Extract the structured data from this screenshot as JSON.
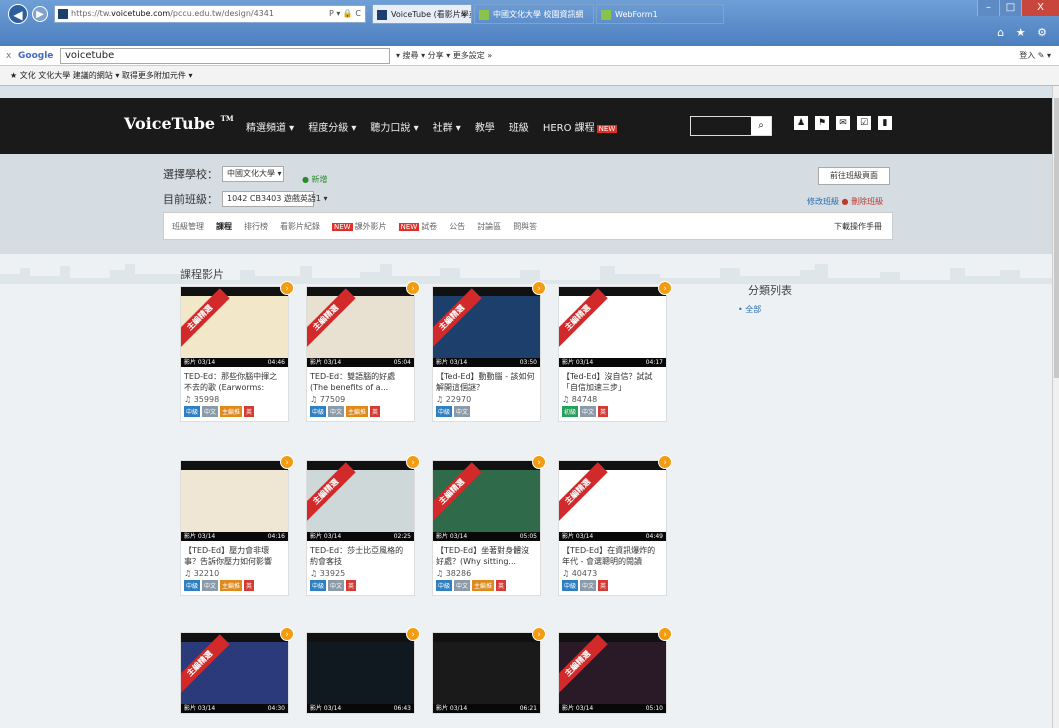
{
  "browser": {
    "url_prefix": "https://tw.",
    "url_host": "voicetube.com",
    "url_path": "/pccu.edu.tw/design/4341",
    "addr_icons": "P ▾ 🔒 C",
    "tabs": [
      {
        "label": "VoiceTube (看影片學英語...",
        "close": "×"
      },
      {
        "label": "中國文化大學 校園資訊網"
      },
      {
        "label": "WebForm1"
      }
    ],
    "window_controls": {
      "min": "–",
      "max": "□",
      "close": "X"
    },
    "right_icons": "⌂ ★ ⚙"
  },
  "google_toolbar": {
    "close": "x",
    "logo": "Google",
    "query": "voicetube",
    "tools": "▾ 搜尋 ▾  分享  ▾  更多設定 »",
    "login": "登入 ✎ ▾"
  },
  "favorites": {
    "text": "★  文化  文化大學  建議的網站 ▾  取得更多附加元件 ▾"
  },
  "header": {
    "logo": "VoiceTube",
    "logo_tm": "TM",
    "nav": [
      "精選頻道 ▾",
      "程度分級 ▾",
      "聽力口說 ▾",
      "社群 ▾",
      "教學",
      "班級",
      "HERO 課程"
    ],
    "nav_new_badge": "NEW",
    "search_btn": "⌕",
    "icons": [
      "♟",
      "⚑",
      "✉",
      "☑",
      "▮"
    ]
  },
  "class_info": {
    "school_label": "選擇學校：",
    "school_value": "中國文化大學 ▾",
    "add_link": "● 新增",
    "class_label": "目前班級：",
    "class_value": "1042 CB3403 遊戲英語1 ▾",
    "goto_btn": "前往班級頁面",
    "edit_link": "修改班級",
    "delete_link": "● 刪除班級"
  },
  "subtabs": {
    "items": [
      "班級管理",
      "課程",
      "排行榜",
      "看影片紀錄",
      "課外影片",
      "試卷",
      "公告",
      "討論區",
      "問與答"
    ],
    "active_index": 1,
    "new_badge": "NEW",
    "download": "下載操作手冊"
  },
  "content": {
    "section_title": "課程影片",
    "category_title": "分類列表",
    "category_all": "• 全部"
  },
  "videos": [
    {
      "title": "TED-Ed：那些你腦中揮之不去的歌 (Earworms:",
      "views": "35998",
      "date": "影片 03/14",
      "duration": "04:46",
      "ribbon": "主編精選",
      "tags": [
        "中級",
        "中文",
        "主編推",
        "英"
      ]
    },
    {
      "title": "TED-Ed：雙語腦的好處 (The benefits of a...",
      "views": "77509",
      "date": "影片 03/14",
      "duration": "05:04",
      "ribbon": "主編精選",
      "tags": [
        "中級",
        "中文",
        "主編推",
        "英"
      ]
    },
    {
      "title": "【Ted-Ed】動動腦 - 該如何解開這個謎？",
      "views": "22970",
      "date": "影片 03/14",
      "duration": "03:50",
      "ribbon": "主編精選",
      "tags": [
        "中級",
        "中文"
      ]
    },
    {
      "title": "【Ted-Ed】沒自信？試試「自信加速三步」",
      "views": "84748",
      "date": "影片 03/14",
      "duration": "04:17",
      "ribbon": "主編精選",
      "tags": [
        "初級",
        "中文",
        "英"
      ]
    },
    {
      "title": "【TED-Ed】壓力會非壞事？告訴你壓力如何影響",
      "views": "32210",
      "date": "影片 03/14",
      "duration": "04:16",
      "ribbon": "",
      "tags": [
        "中級",
        "中文",
        "主編推",
        "英"
      ]
    },
    {
      "title": "TED-Ed：莎士比亞風格的約會客技",
      "views": "33925",
      "date": "影片 03/14",
      "duration": "02:25",
      "ribbon": "主編精選",
      "tags": [
        "中級",
        "中文",
        "英"
      ]
    },
    {
      "title": "【TED-Ed】坐著對身體沒好處？(Why sitting...",
      "views": "38286",
      "date": "影片 03/14",
      "duration": "05:05",
      "ribbon": "主編精選",
      "tags": [
        "中級",
        "中文",
        "主編推",
        "英"
      ]
    },
    {
      "title": "【TED-Ed】在資訊爆炸的年代 - 會選聰明的閱讀",
      "views": "40473",
      "date": "影片 03/14",
      "duration": "04:49",
      "ribbon": "主編精選",
      "tags": [
        "中級",
        "中文",
        "英"
      ]
    },
    {
      "title": "",
      "views": "",
      "date": "影片 03/14",
      "duration": "04:30",
      "ribbon": "主編精選",
      "tags": []
    },
    {
      "title": "",
      "views": "",
      "date": "影片 03/14",
      "duration": "06:43",
      "ribbon": "",
      "tags": []
    },
    {
      "title": "",
      "views": "",
      "date": "影片 03/14",
      "duration": "06:21",
      "ribbon": "",
      "tags": []
    },
    {
      "title": "",
      "views": "",
      "date": "影片 03/14",
      "duration": "05:10",
      "ribbon": "主編精選",
      "tags": []
    }
  ],
  "colors": {
    "header_bg": "#1a1a1a",
    "accent_orange": "#f39c12",
    "ribbon_red": "#d22a2a",
    "link_blue": "#2b6cb0"
  }
}
